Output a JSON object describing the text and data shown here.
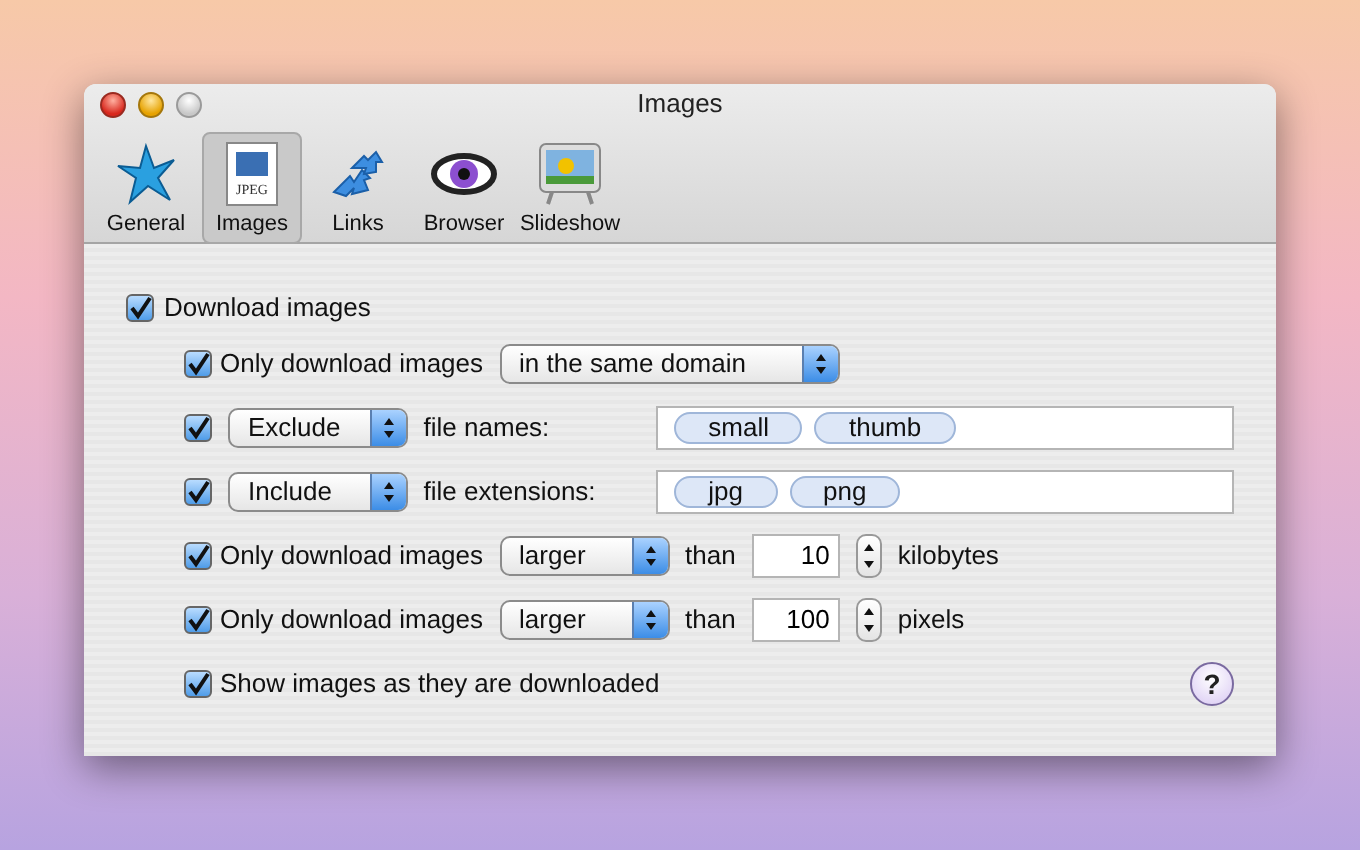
{
  "window": {
    "title": "Images"
  },
  "toolbar": [
    {
      "label": "General",
      "selected": false
    },
    {
      "label": "Images",
      "selected": true,
      "icon_text": "JPEG"
    },
    {
      "label": "Links",
      "selected": false
    },
    {
      "label": "Browser",
      "selected": false
    },
    {
      "label": "Slideshow",
      "selected": false
    }
  ],
  "download_images": {
    "label": "Download images",
    "checked": true
  },
  "rows": [
    {
      "kind": "select",
      "checked": true,
      "label": "Only download images",
      "popup": "in the same domain"
    },
    {
      "kind": "tokens",
      "checked": true,
      "popup": "Exclude",
      "label": "file names:",
      "tokens": [
        "small",
        "thumb"
      ]
    },
    {
      "kind": "tokens",
      "checked": true,
      "popup": "Include",
      "label": "file extensions:",
      "tokens": [
        "jpg",
        "png"
      ]
    },
    {
      "kind": "size",
      "checked": true,
      "label": "Only download images",
      "popup": "larger",
      "than": "than",
      "value": "10",
      "unit": "kilobytes"
    },
    {
      "kind": "size",
      "checked": true,
      "label": "Only download images",
      "popup": "larger",
      "than": "than",
      "value": "100",
      "unit": "pixels"
    },
    {
      "kind": "check",
      "checked": true,
      "label": "Show images as they are downloaded"
    }
  ],
  "help": "?"
}
